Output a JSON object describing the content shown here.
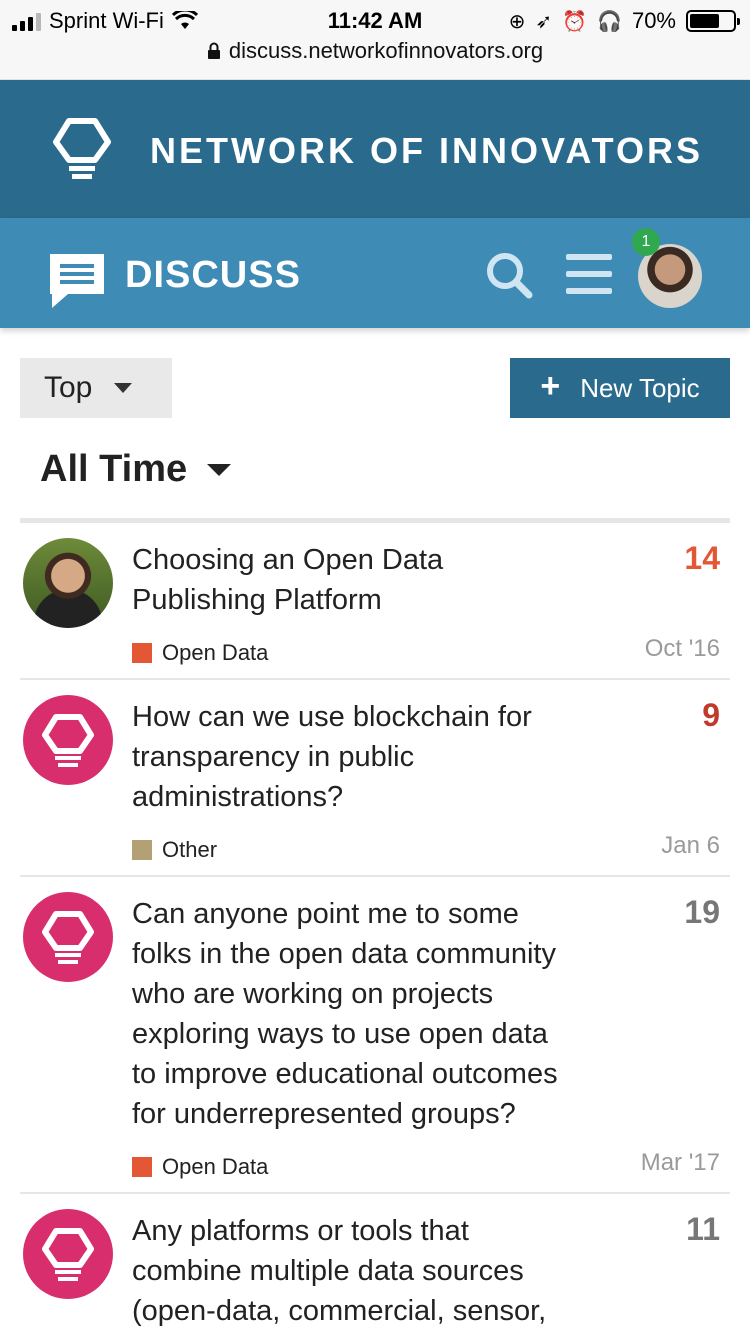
{
  "status_bar": {
    "carrier": "Sprint Wi-Fi",
    "time": "11:42 AM",
    "battery": "70%",
    "battery_level": 0.7,
    "url": "discuss.networkofinnovators.org"
  },
  "brand": {
    "title": "NETWORK OF INNOVATORS"
  },
  "discuss_bar": {
    "title": "DISCUSS",
    "notification_count": "1"
  },
  "controls": {
    "sort_label": "Top",
    "new_topic_label": "New Topic",
    "period_label": "All Time"
  },
  "colors": {
    "brand_dark": "#2a6a8c",
    "brand_light": "#3e8bb6",
    "accent_pink": "#d92e6e",
    "open_data": "#e45735",
    "other": "#b3a075",
    "notification": "#2fa84f"
  },
  "topics": [
    {
      "title_lines": [
        "Choosing an Open Data",
        "Publishing Platform"
      ],
      "count": "14",
      "count_color": "#e45735",
      "category": "Open Data",
      "category_color": "#e45735",
      "date": "Oct '16",
      "avatar": "user-photo"
    },
    {
      "title_lines": [
        "How can we use blockchain for",
        "transparency in public",
        "administrations?"
      ],
      "count": "9",
      "count_color": "#c0392b",
      "category": "Other",
      "category_color": "#b3a075",
      "date": "Jan 6",
      "avatar": "noi-logo"
    },
    {
      "title_lines": [
        "Can anyone point me to some",
        "folks in the open data community",
        "who are working on projects",
        "exploring ways to use open data",
        "to improve educational outcomes",
        "for underrepresented groups?"
      ],
      "count": "19",
      "count_color": "#777777",
      "category": "Open Data",
      "category_color": "#e45735",
      "date": "Mar '17",
      "avatar": "noi-logo"
    },
    {
      "title_lines": [
        "Any platforms or tools that",
        "combine multiple data sources",
        "(open-data, commercial, sensor,"
      ],
      "count": "11",
      "count_color": "#777777",
      "category": "",
      "category_color": "",
      "date": "",
      "avatar": "noi-logo"
    }
  ]
}
